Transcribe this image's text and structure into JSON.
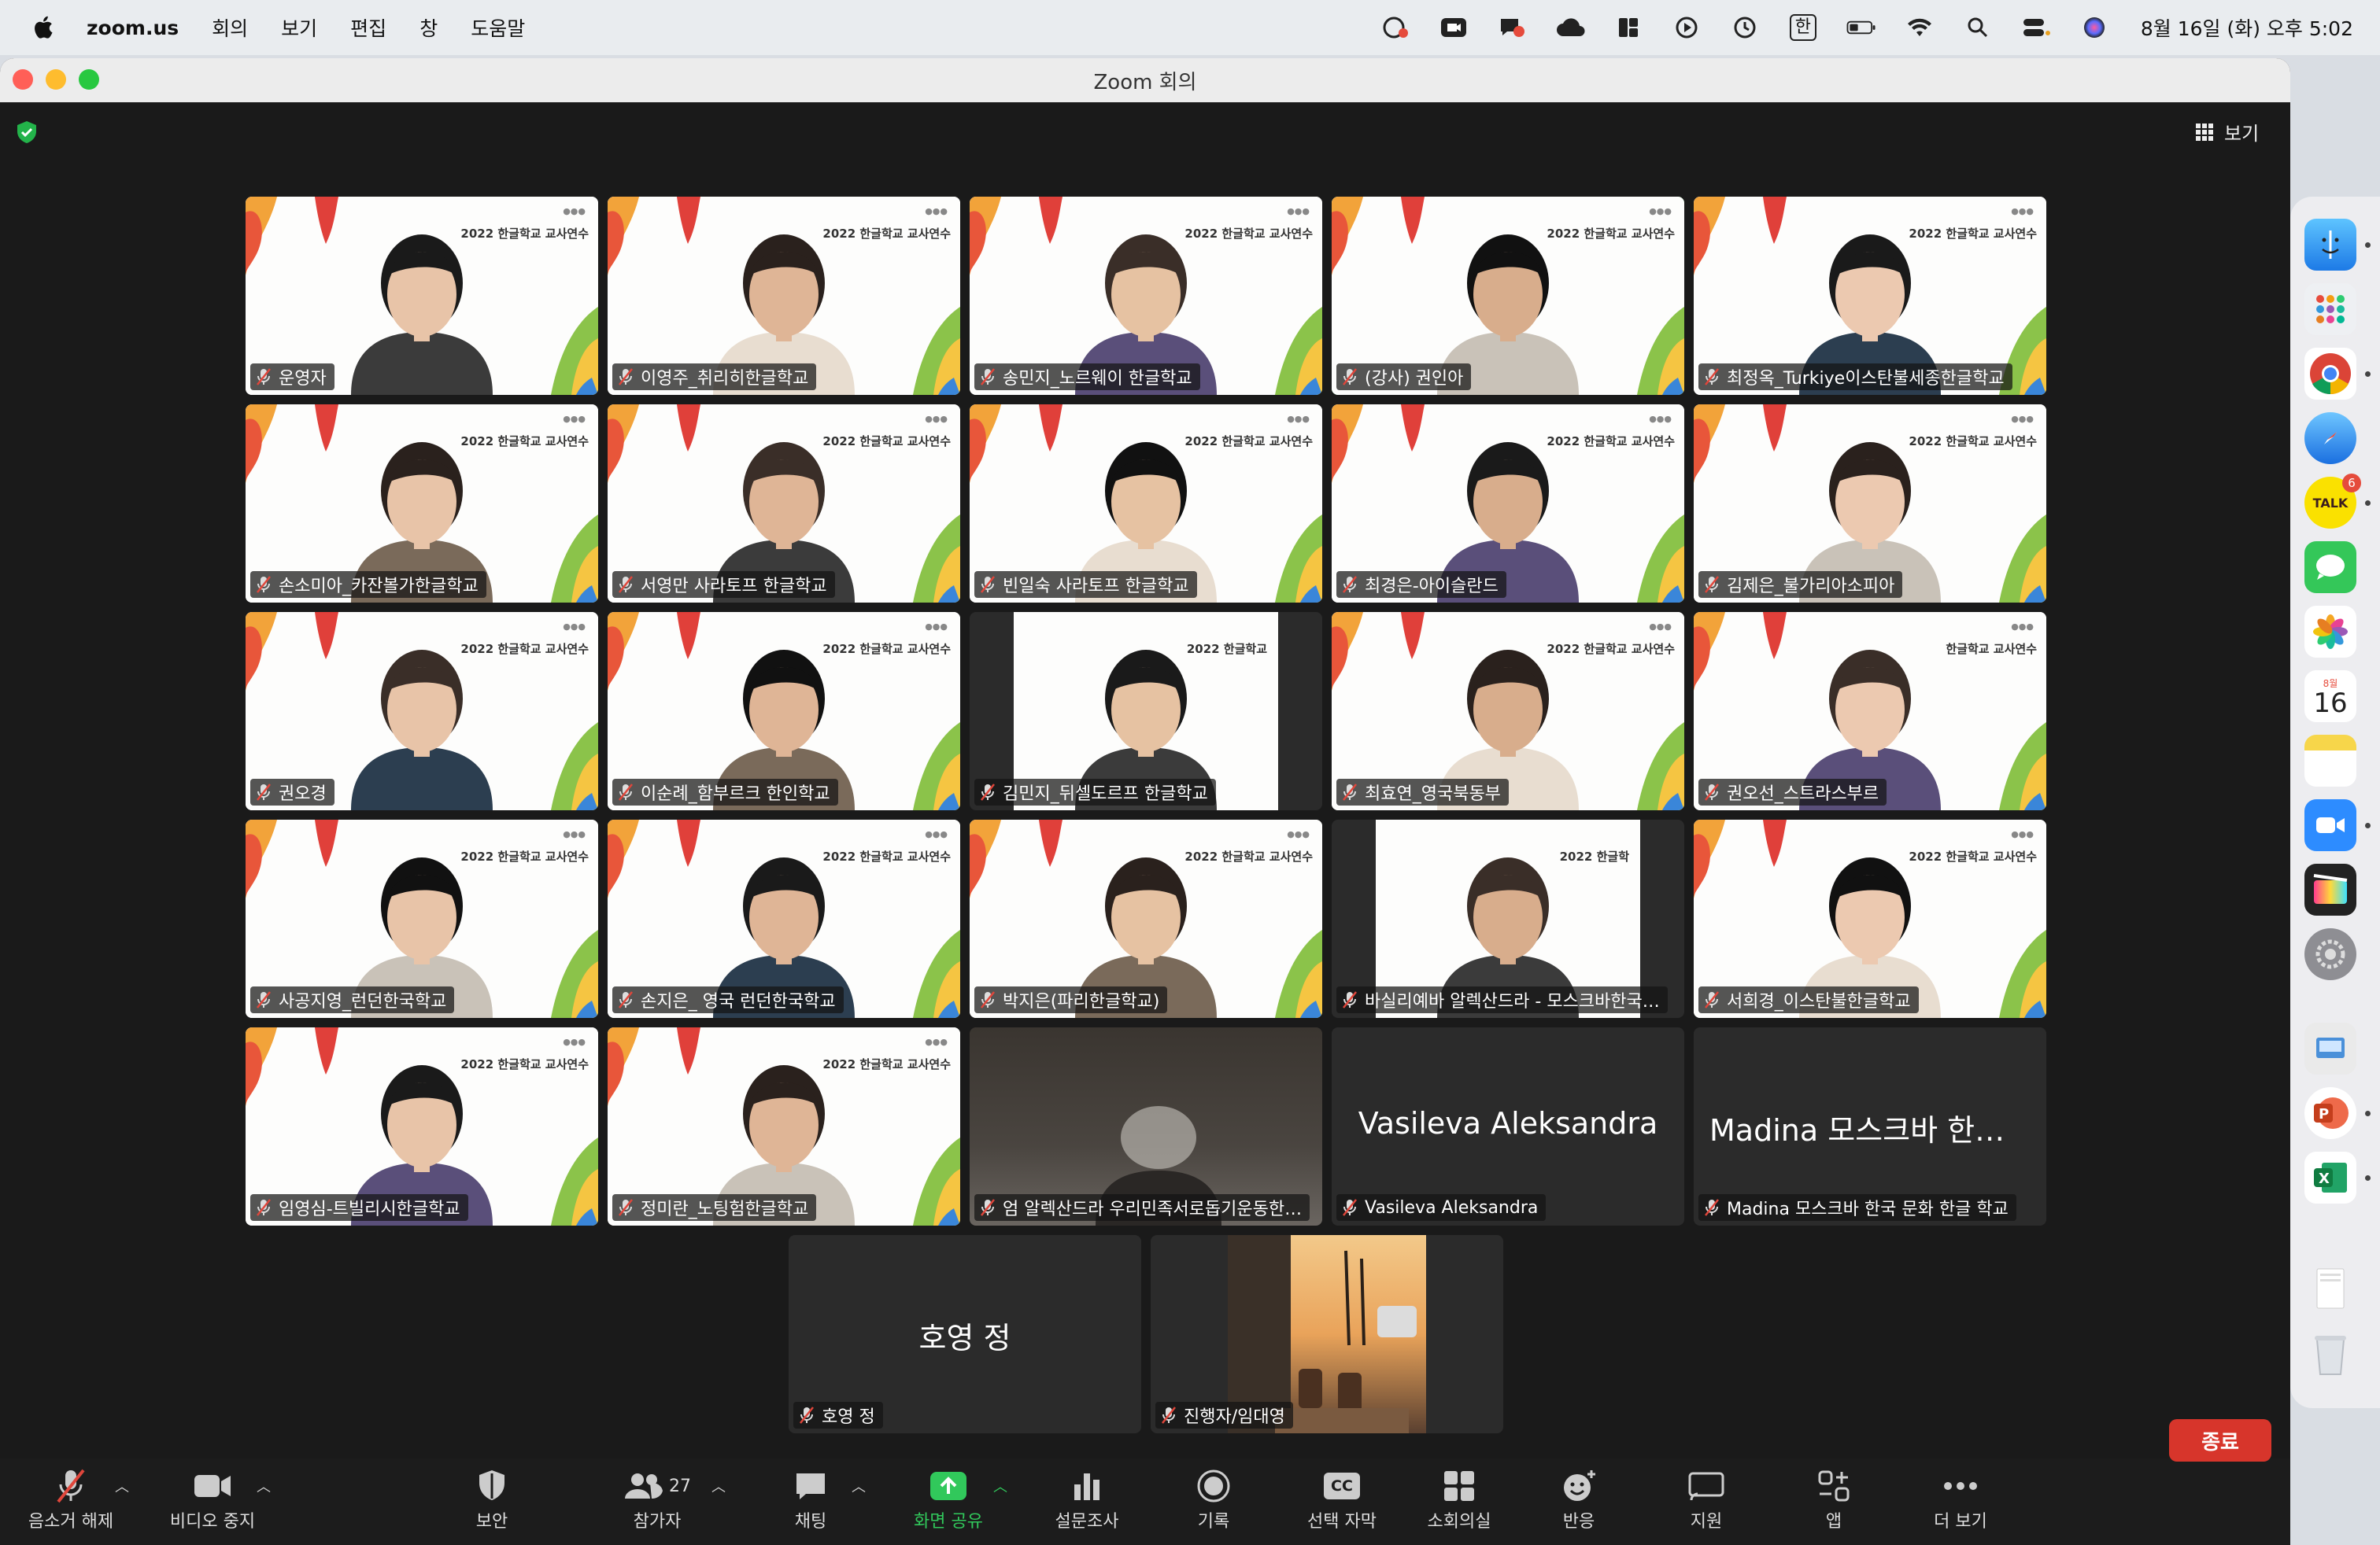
{
  "menubar": {
    "app_name": "zoom.us",
    "items": [
      "회의",
      "보기",
      "편집",
      "창",
      "도움말"
    ],
    "input_method": "한",
    "clock": "8월 16일 (화) 오후 5:02"
  },
  "window": {
    "title": "Zoom 회의",
    "view_label": "보기"
  },
  "tiles": [
    {
      "name": "운영자",
      "banner": "2022 한글학교 교사연수",
      "kind": "video",
      "active": false
    },
    {
      "name": "이영주_취리히한글학교",
      "banner": "2022 한글학교 교사연수",
      "kind": "video",
      "active": false
    },
    {
      "name": "송민지_노르웨이 한글학교",
      "banner": "2022 한글학교 교사연수",
      "kind": "video",
      "active": false
    },
    {
      "name": "(강사) 권인아",
      "banner": "2022 한글학교 교사연수",
      "kind": "video",
      "active": true
    },
    {
      "name": "최정옥_Turkiye이스탄불세종한글학교",
      "banner": "2022 한글학교 교사연수",
      "kind": "video",
      "active": false
    },
    {
      "name": "손소미아_카잔볼가한글학교",
      "banner": "2022 한글학교 교사연수",
      "kind": "video",
      "active": false
    },
    {
      "name": "서영만 사라토프 한글학교",
      "banner": "2022 한글학교 교사연수",
      "kind": "video",
      "active": false
    },
    {
      "name": "빈일숙 사라토프 한글학교",
      "banner": "2022 한글학교 교사연수",
      "kind": "video",
      "active": false
    },
    {
      "name": "최경은-아이슬란드",
      "banner": "2022 한글학교 교사연수",
      "kind": "video",
      "active": false
    },
    {
      "name": "김제은_불가리아소피아",
      "banner": "2022 한글학교 교사연수",
      "kind": "video",
      "active": false
    },
    {
      "name": "권오경",
      "banner": "2022 한글학교 교사연수",
      "kind": "video",
      "active": false
    },
    {
      "name": "이순례_함부르크 한인학교",
      "banner": "2022 한글학교 교사연수",
      "kind": "video",
      "active": false
    },
    {
      "name": "김민지_뒤셀도르프 한글학교",
      "banner": "2022 한글학교",
      "kind": "narrow",
      "active": false
    },
    {
      "name": "최효연_영국북동부",
      "banner": "2022 한글학교 교사연수",
      "kind": "video",
      "active": false
    },
    {
      "name": "권오선_스트라스부르",
      "banner": "한글학교 교사연수",
      "kind": "video",
      "active": false
    },
    {
      "name": "사공지영_런던한국학교",
      "banner": "2022 한글학교 교사연수",
      "kind": "video",
      "active": false
    },
    {
      "name": "손지은_ 영국 런던한국학교",
      "banner": "2022 한글학교 교사연수",
      "kind": "video",
      "active": false
    },
    {
      "name": "박지은(파리한글학교)",
      "banner": "2022 한글학교 교사연수",
      "kind": "video",
      "active": false
    },
    {
      "name": "바실리예바 알렉산드라 - 모스크바한국…",
      "banner": "2022 한글학",
      "kind": "narrow",
      "active": false
    },
    {
      "name": "서희경_이스탄불한글학교",
      "banner": "2022 한글학교 교사연수",
      "kind": "video",
      "active": false
    },
    {
      "name": "임영심-트빌리시한글학교",
      "banner": "2022 한글학교 교사연수",
      "kind": "video",
      "active": false
    },
    {
      "name": "정미란_노팅험한글학교",
      "banner": "2022 한글학교 교사연수",
      "kind": "video",
      "active": false
    },
    {
      "name": "엄 알렉산드라 우리민족서로돕기운동한…",
      "banner": "",
      "kind": "darkvideo",
      "active": false
    },
    {
      "name": "Vasileva Aleksandra",
      "banner": "",
      "kind": "noVideo",
      "big": "Vasileva Aleksandra",
      "active": false
    },
    {
      "name": "Madina 모스크바 한국 문화 한글 학교",
      "banner": "",
      "kind": "noVideo",
      "big": "Madina 모스크바 한국...",
      "active": false
    },
    {
      "name": "호영 정",
      "banner": "",
      "kind": "noVideo",
      "big": "호영 정",
      "active": false
    },
    {
      "name": "진행자/임대영",
      "banner": "",
      "kind": "photo",
      "active": false
    }
  ],
  "toolbar": {
    "mute": "음소거 해제",
    "video": "비디오 중지",
    "security": "보안",
    "participants": "참가자",
    "participants_count": "27",
    "chat": "채팅",
    "share": "화면 공유",
    "polls": "설문조사",
    "record": "기록",
    "captions": "선택 자막",
    "captions_icon": "CC",
    "breakout": "소회의실",
    "reactions": "반응",
    "support": "지원",
    "apps": "앱",
    "more": "더 보기",
    "end": "종료"
  },
  "dock": {
    "kakao_badge": "6",
    "calendar_month": "8월",
    "calendar_day": "16",
    "kakao_label": "TALK"
  },
  "colors": {
    "accent_green": "#2fcc4f",
    "end_red": "#d7352b",
    "share_green": "#31c85b"
  }
}
